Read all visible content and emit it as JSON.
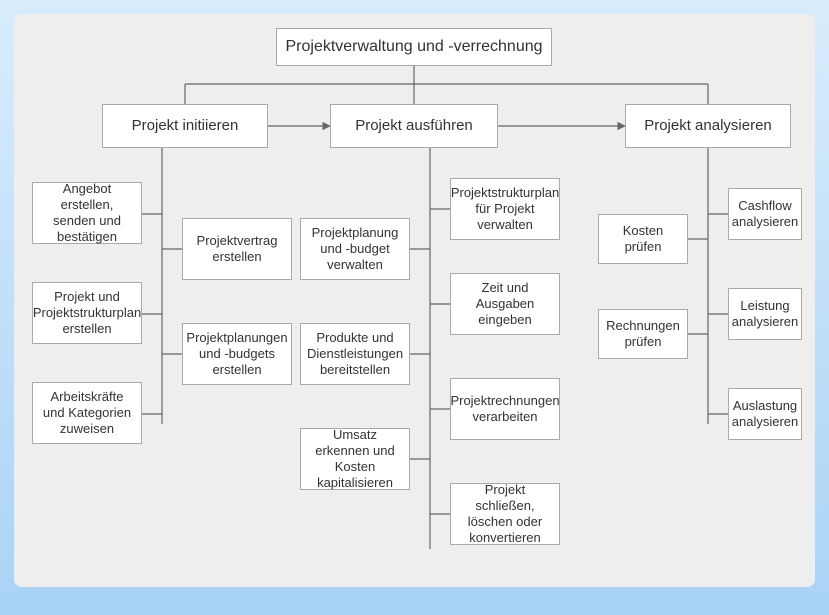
{
  "title": "Projektverwaltung und -verrechnung",
  "phases": {
    "initiate": "Projekt initiieren",
    "execute": "Projekt ausführen",
    "analyze": "Projekt analysieren"
  },
  "initiate": {
    "left": [
      "Angebot erstellen, senden und bestätigen",
      "Projekt und Projektstrukturplan erstellen",
      "Arbeitskräfte und Kategorien zuweisen"
    ],
    "right": [
      "Projektvertrag erstellen",
      "Projektplanungen und -budgets erstellen"
    ]
  },
  "execute": {
    "left": [
      "Projektplanung und -budget verwalten",
      "Produkte und Dienstleistungen bereitstellen",
      "Umsatz erkennen und Kosten kapitalisieren"
    ],
    "right": [
      "Projektstrukturplan für Projekt verwalten",
      "Zeit und Ausgaben eingeben",
      "Projektrechnungen verarbeiten",
      "Projekt schließen, löschen oder konvertieren"
    ]
  },
  "analyze": {
    "left": [
      "Kosten prüfen",
      "Rechnungen prüfen"
    ],
    "right": [
      "Cashflow analysieren",
      "Leistung analysieren",
      "Auslastung analysieren"
    ]
  }
}
